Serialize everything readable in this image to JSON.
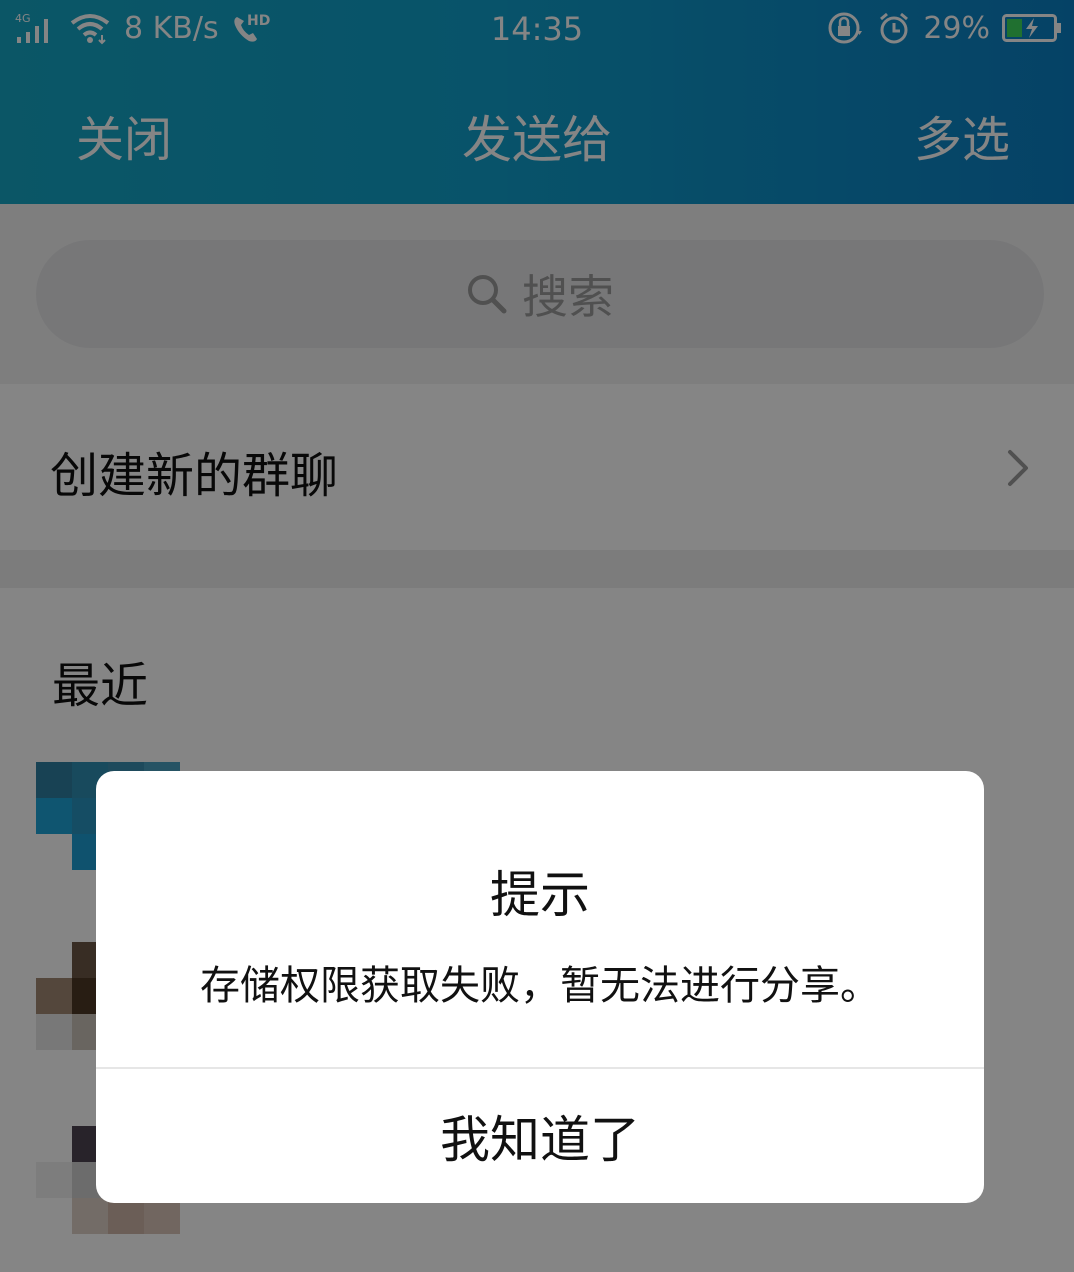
{
  "status_bar": {
    "network": "4G",
    "speed": "8 KB/s",
    "call_badge": "HD",
    "time": "14:35",
    "battery": "29%"
  },
  "nav": {
    "close_label": "关闭",
    "title": "发送给",
    "multi_select_label": "多选"
  },
  "search": {
    "placeholder": "搜索"
  },
  "group": {
    "create_label": "创建新的群聊"
  },
  "recent": {
    "title": "最近"
  },
  "dialog": {
    "title": "提示",
    "message": "存储权限获取失败，暂无法进行分享。",
    "button_label": "我知道了"
  },
  "colors": {
    "header_start": "#16a6c4",
    "header_end": "#0b7fc4",
    "page_background": "#f2f2f2",
    "dialog_background": "#ffffff",
    "battery_green": "#3fd65c"
  },
  "icons": [
    "signal-icon",
    "wifi-icon",
    "hd-call-icon",
    "rotation-lock-icon",
    "alarm-icon",
    "battery-charging-icon",
    "search-icon",
    "chevron-right-icon"
  ]
}
